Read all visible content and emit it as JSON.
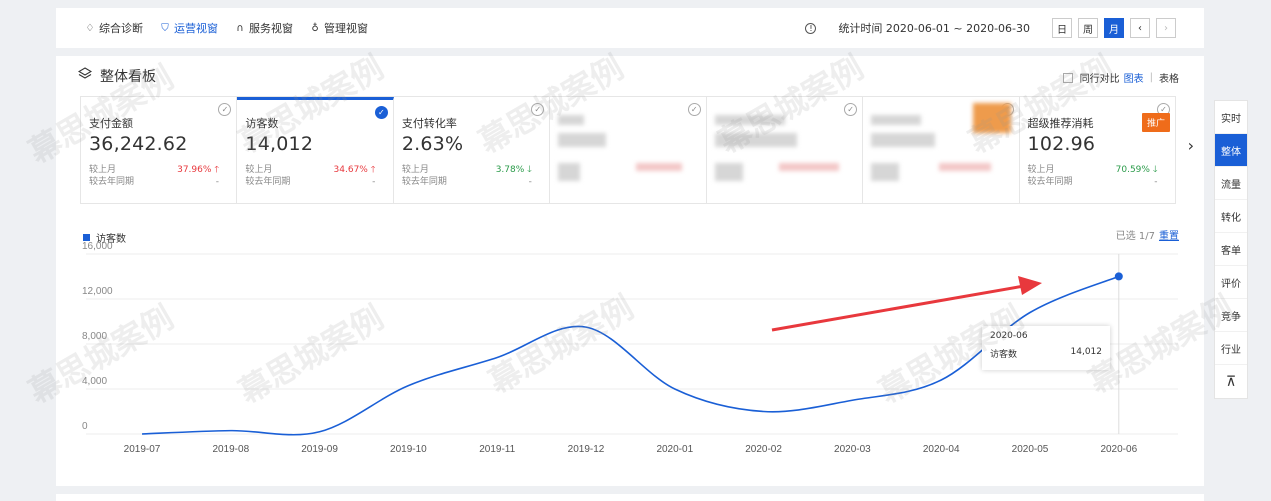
{
  "topbar": {
    "tabs": [
      {
        "label": "综合诊断",
        "icon": "diagnosis-icon",
        "active": false
      },
      {
        "label": "运营视窗",
        "icon": "shield-icon",
        "active": true
      },
      {
        "label": "服务视窗",
        "icon": "headset-icon",
        "active": false
      },
      {
        "label": "管理视窗",
        "icon": "bulb-icon",
        "active": false
      }
    ],
    "period_text": "统计时间 2020-06-01 ~ 2020-06-30",
    "period_buttons": [
      "日",
      "周",
      "月"
    ],
    "active_period": "月",
    "prev_symbol": "‹",
    "next_symbol": "›"
  },
  "panel": {
    "title": "整体看板",
    "compare_label": "同行对比",
    "view_chart": "图表",
    "view_table": "表格",
    "cards": [
      {
        "label": "支付金额",
        "value": "36,242.62",
        "mom_label": "较上月",
        "mom": "37.96%",
        "mom_dir": "up",
        "yoy_label": "较去年同期",
        "yoy": "-",
        "selected": false
      },
      {
        "label": "访客数",
        "value": "14,012",
        "mom_label": "较上月",
        "mom": "34.67%",
        "mom_dir": "up",
        "yoy_label": "较去年同期",
        "yoy": "-",
        "selected": true
      },
      {
        "label": "支付转化率",
        "value": "2.63%",
        "mom_label": "较上月",
        "mom": "3.78%",
        "mom_dir": "down",
        "yoy_label": "较去年同期",
        "yoy": "-",
        "selected": false
      },
      {
        "label": "超级推荐消耗",
        "value": "102.96",
        "mom_label": "较上月",
        "mom": "70.59%",
        "mom_dir": "down",
        "yoy_label": "较去年同期",
        "yoy": "-",
        "badge": "推广",
        "selected": false
      }
    ],
    "legend": "访客数",
    "selected_info": "已选 1/7",
    "reset": "重置"
  },
  "chart_data": {
    "type": "line",
    "categories": [
      "2019-07",
      "2019-08",
      "2019-09",
      "2019-10",
      "2019-11",
      "2019-12",
      "2020-01",
      "2020-02",
      "2020-03",
      "2020-04",
      "2020-05",
      "2020-06"
    ],
    "series": [
      {
        "name": "访客数",
        "values": [
          0,
          300,
          200,
          4300,
          6800,
          9500,
          4000,
          2000,
          3000,
          4800,
          10800,
          14012
        ]
      }
    ],
    "y_ticks": [
      "0",
      "4,000",
      "8,000",
      "12,000",
      "16,000"
    ],
    "ylim": [
      0,
      16000
    ],
    "grid": true,
    "color": "#1a5fd6",
    "tooltip": {
      "title": "2020-06",
      "label": "访客数",
      "value": "14,012"
    }
  },
  "sidebar": {
    "items": [
      "实时",
      "整体",
      "流量",
      "转化",
      "客单",
      "评价",
      "竞争",
      "行业"
    ],
    "active": "整体",
    "top_symbol": "⊼"
  },
  "watermark": "幕思城案例",
  "colors": {
    "accent": "#1a5fd6",
    "up": "#e8383d",
    "down": "#2b9b4a",
    "promo": "#ef6c1a",
    "arrow": "#e8383d"
  }
}
